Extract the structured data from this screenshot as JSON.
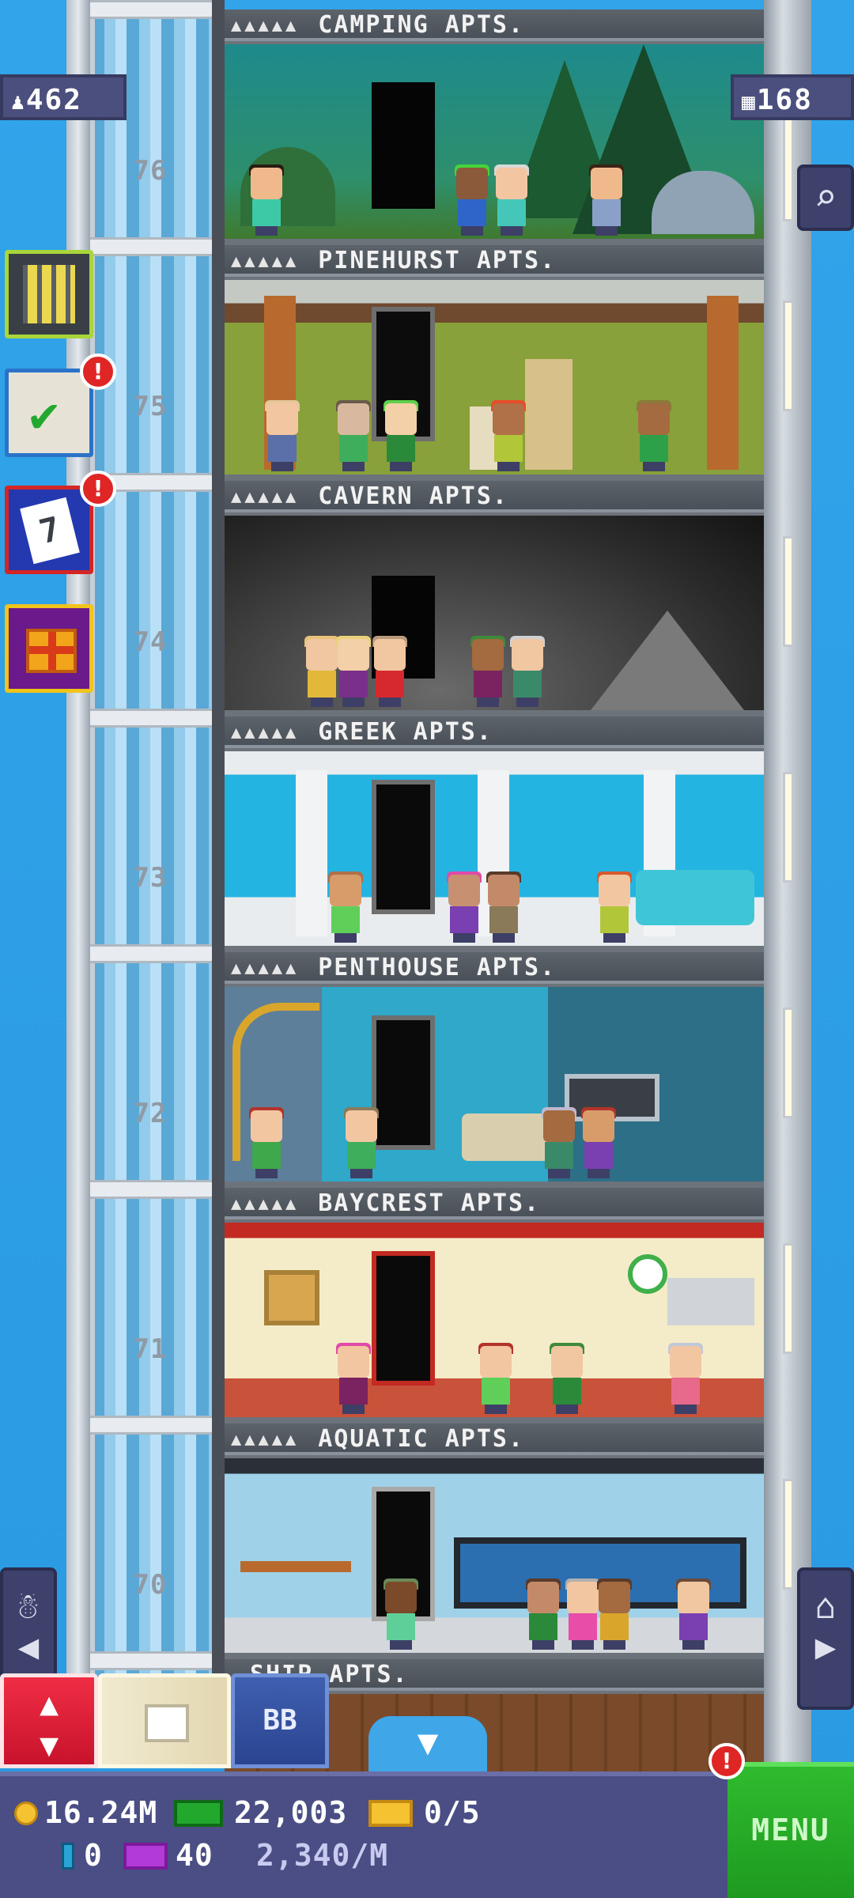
{
  "hud": {
    "population": "462",
    "floor_count": "168"
  },
  "floors": [
    {
      "number": "76",
      "sign": "CAMPING APTS."
    },
    {
      "number": "75",
      "sign": "PINEHURST APTS."
    },
    {
      "number": "74",
      "sign": "CAVERN APTS."
    },
    {
      "number": "73",
      "sign": "GREEK APTS."
    },
    {
      "number": "72",
      "sign": "PENTHOUSE APTS."
    },
    {
      "number": "71",
      "sign": "BAYCREST APTS."
    },
    {
      "number": "70",
      "sign": "AQUATIC APTS."
    },
    {
      "number": "",
      "sign": "SHIP APTS."
    }
  ],
  "stars": "▲▲▲▲▲",
  "side_buttons": {
    "missions_alert": "!",
    "calendar_alert": "!",
    "calendar_day": "7",
    "menu_alert": "!"
  },
  "toolbar": {
    "bb_label": "BB"
  },
  "bottom_bar": {
    "coins": "16.24M",
    "bux": "22,003",
    "tickets": "0/5",
    "vip": "0",
    "golden_tickets": "40",
    "rate": "2,340/M",
    "menu_label": "MENU"
  },
  "colors": {
    "sky": "#2a9ae2",
    "bottom_bar": "#4a4e84",
    "menu_green": "#1e9a20",
    "alert_red": "#e02525",
    "elevator_red": "#e5203a"
  },
  "icons": [
    "population-icon",
    "floors-icon",
    "search-icon",
    "building-icon",
    "missions-icon",
    "calendar-icon",
    "gift-icon",
    "elevator-icon",
    "box-icon",
    "down-arrow-icon",
    "bitizen-icon",
    "home-icon",
    "coin-icon",
    "bux-icon",
    "ticket-icon",
    "vip-icon",
    "golden-ticket-icon"
  ]
}
